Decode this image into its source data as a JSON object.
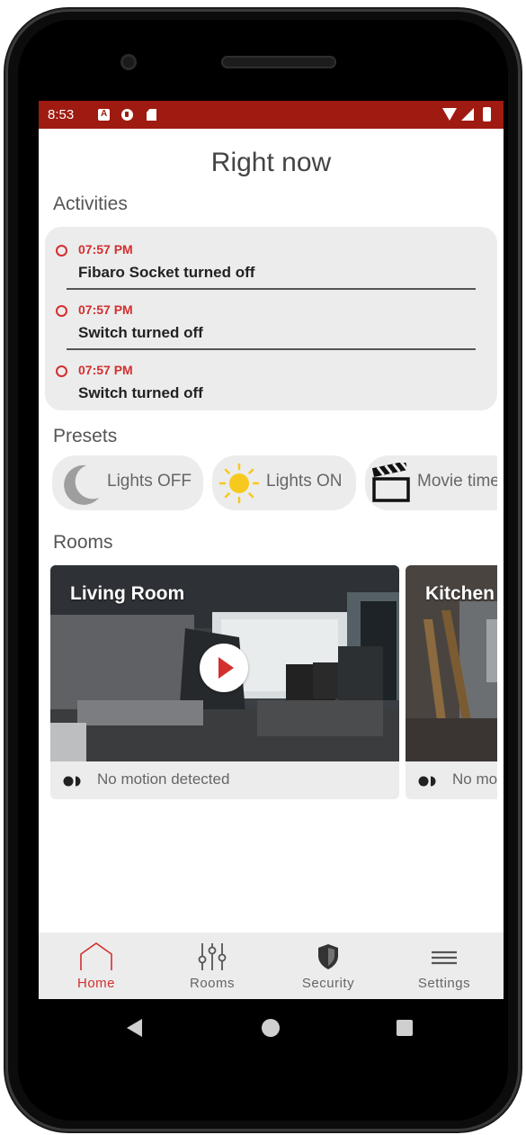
{
  "status_bar": {
    "time": "8:53"
  },
  "page": {
    "title": "Right now"
  },
  "activities": {
    "heading": "Activities",
    "items": [
      {
        "time": "07:57 PM",
        "text": "Fibaro Socket turned off"
      },
      {
        "time": "07:57 PM",
        "text": "Switch turned off"
      },
      {
        "time": "07:57 PM",
        "text": "Switch turned off"
      }
    ]
  },
  "presets": {
    "heading": "Presets",
    "items": [
      {
        "label": "Lights OFF",
        "icon": "moon-icon"
      },
      {
        "label": "Lights ON",
        "icon": "sun-icon"
      },
      {
        "label": "Movie time",
        "icon": "clapperboard-icon"
      }
    ]
  },
  "rooms": {
    "heading": "Rooms",
    "items": [
      {
        "name": "Living Room",
        "motion": "No motion detected"
      },
      {
        "name": "Kitchen",
        "motion": "No motion detected"
      }
    ]
  },
  "nav": {
    "items": [
      {
        "label": "Home",
        "icon": "home-icon",
        "active": true
      },
      {
        "label": "Rooms",
        "icon": "sliders-icon"
      },
      {
        "label": "Security",
        "icon": "shield-icon"
      },
      {
        "label": "Settings",
        "icon": "menu-icon"
      }
    ]
  },
  "colors": {
    "status_bar": "#9f1a10",
    "accent": "#d32f2f",
    "card": "#ececec"
  }
}
